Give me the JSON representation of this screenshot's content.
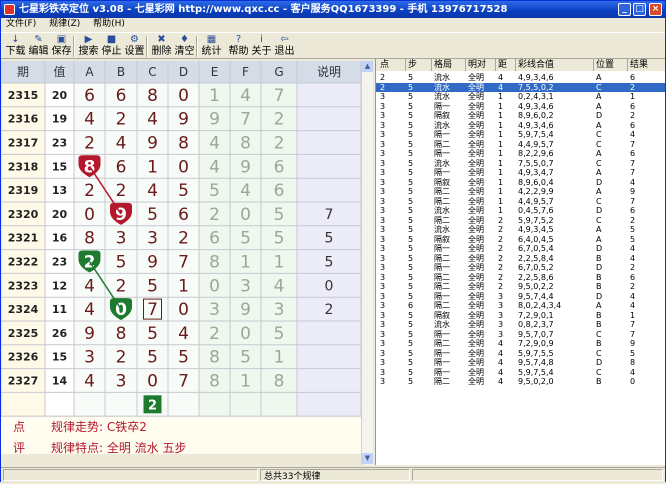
{
  "window": {
    "title": "七星彩铁卒定位 v3.08 - 七星彩网 http://www.qxc.cc - 客户服务QQ1673399 - 手机 13976717528",
    "min_label": "_",
    "max_label": "□",
    "close_label": "×"
  },
  "menu": [
    "文件(F)",
    "规律(Z)",
    "帮助(H)"
  ],
  "toolbar": [
    {
      "label": "下载",
      "icon": "download-icon",
      "glyph": "↓"
    },
    {
      "label": "编辑",
      "icon": "edit-icon",
      "glyph": "✎"
    },
    {
      "label": "保存",
      "icon": "save-icon",
      "glyph": "▣"
    },
    {
      "label": "搜索",
      "icon": "search-icon",
      "glyph": "▶"
    },
    {
      "label": "停止",
      "icon": "stop-icon",
      "glyph": "■"
    },
    {
      "label": "设置",
      "icon": "settings-icon",
      "glyph": "⚙"
    },
    {
      "label": "删除",
      "icon": "delete-icon",
      "glyph": "✖"
    },
    {
      "label": "清空",
      "icon": "clear-icon",
      "glyph": "♦"
    },
    {
      "label": "统计",
      "icon": "stats-icon",
      "glyph": "▦"
    },
    {
      "label": "帮助",
      "icon": "help-icon",
      "glyph": "?"
    },
    {
      "label": "关于",
      "icon": "about-icon",
      "glyph": "i"
    },
    {
      "label": "退出",
      "icon": "exit-icon",
      "glyph": "⇦"
    }
  ],
  "grid": {
    "headers": [
      "期",
      "值",
      "A",
      "B",
      "C",
      "D",
      "E",
      "F",
      "G",
      "说明"
    ],
    "rows": [
      {
        "period": "2315",
        "value": "20",
        "digits": [
          "6",
          "6",
          "8",
          "0",
          "1",
          "4",
          "7"
        ],
        "note": ""
      },
      {
        "period": "2316",
        "value": "19",
        "digits": [
          "4",
          "2",
          "4",
          "9",
          "9",
          "7",
          "2"
        ],
        "note": ""
      },
      {
        "period": "2317",
        "value": "23",
        "digits": [
          "2",
          "4",
          "9",
          "8",
          "4",
          "8",
          "2"
        ],
        "note": ""
      },
      {
        "period": "2318",
        "value": "15",
        "digits": [
          "8",
          "6",
          "1",
          "0",
          "4",
          "9",
          "6"
        ],
        "note": ""
      },
      {
        "period": "2319",
        "value": "13",
        "digits": [
          "2",
          "2",
          "4",
          "5",
          "5",
          "4",
          "6"
        ],
        "note": ""
      },
      {
        "period": "2320",
        "value": "20",
        "digits": [
          "0",
          "9",
          "5",
          "6",
          "2",
          "0",
          "5"
        ],
        "note": "7"
      },
      {
        "period": "2321",
        "value": "16",
        "digits": [
          "8",
          "3",
          "3",
          "2",
          "6",
          "5",
          "5"
        ],
        "note": "5"
      },
      {
        "period": "2322",
        "value": "23",
        "digits": [
          "2",
          "5",
          "9",
          "7",
          "8",
          "1",
          "1"
        ],
        "note": "5"
      },
      {
        "period": "2323",
        "value": "12",
        "digits": [
          "4",
          "2",
          "5",
          "1",
          "0",
          "3",
          "4"
        ],
        "note": "0"
      },
      {
        "period": "2324",
        "value": "11",
        "digits": [
          "4",
          "0",
          "7",
          "0",
          "3",
          "9",
          "3"
        ],
        "note": "2"
      },
      {
        "period": "2325",
        "value": "26",
        "digits": [
          "9",
          "8",
          "5",
          "4",
          "2",
          "0",
          "5"
        ],
        "note": ""
      },
      {
        "period": "2326",
        "value": "15",
        "digits": [
          "3",
          "2",
          "5",
          "5",
          "8",
          "5",
          "1"
        ],
        "note": ""
      },
      {
        "period": "2327",
        "value": "14",
        "digits": [
          "4",
          "3",
          "0",
          "7",
          "8",
          "1",
          "8"
        ],
        "note": ""
      }
    ],
    "next_hint": "2",
    "info_label_1": "点",
    "info_label_2": "评",
    "info_line_1": "规律走势: C铁卒2",
    "info_line_2": "规律特点: 全明  流水  五步"
  },
  "list": {
    "headers": [
      "点",
      "步",
      "格局",
      "明对",
      "距",
      "彩线合值",
      "位置",
      "结果"
    ],
    "rows": [
      [
        "2",
        "5",
        "流水",
        "全明",
        "4",
        "4,9,3,4,6",
        "A",
        "6"
      ],
      [
        "2",
        "5",
        "流水",
        "全明",
        "4",
        "7,5,5,0,2",
        "C",
        "2"
      ],
      [
        "3",
        "5",
        "流水",
        "全明",
        "1",
        "0,2,4,3,1",
        "A",
        "1"
      ],
      [
        "3",
        "5",
        "隔一",
        "全明",
        "1",
        "4,9,3,4,6",
        "A",
        "6"
      ],
      [
        "3",
        "5",
        "隔叙",
        "全明",
        "1",
        "8,9,6,0,2",
        "D",
        "2"
      ],
      [
        "3",
        "5",
        "流水",
        "全明",
        "1",
        "4,9,3,4,6",
        "A",
        "6"
      ],
      [
        "3",
        "5",
        "隔一",
        "全明",
        "1",
        "5,9,7,5,4",
        "C",
        "4"
      ],
      [
        "3",
        "5",
        "隔二",
        "全明",
        "1",
        "4,4,9,5,7",
        "C",
        "7"
      ],
      [
        "3",
        "5",
        "隔一",
        "全明",
        "1",
        "8,2,2,9,6",
        "A",
        "6"
      ],
      [
        "3",
        "5",
        "流水",
        "全明",
        "1",
        "7,5,5,0,7",
        "C",
        "7"
      ],
      [
        "3",
        "5",
        "隔一",
        "全明",
        "1",
        "4,9,3,4,7",
        "A",
        "7"
      ],
      [
        "3",
        "5",
        "隔叙",
        "全明",
        "1",
        "8,9,6,0,4",
        "D",
        "4"
      ],
      [
        "3",
        "5",
        "隔二",
        "全明",
        "1",
        "4,2,2,9,9",
        "A",
        "9"
      ],
      [
        "3",
        "5",
        "隔二",
        "全明",
        "1",
        "4,4,9,5,7",
        "C",
        "7"
      ],
      [
        "3",
        "5",
        "流水",
        "全明",
        "1",
        "0,4,5,7,6",
        "D",
        "6"
      ],
      [
        "3",
        "5",
        "隔二",
        "全明",
        "2",
        "5,9,7,5,2",
        "C",
        "2"
      ],
      [
        "3",
        "5",
        "流水",
        "全明",
        "2",
        "4,9,3,4,5",
        "A",
        "5"
      ],
      [
        "3",
        "5",
        "隔叙",
        "全明",
        "2",
        "6,4,0,4,5",
        "A",
        "5"
      ],
      [
        "3",
        "5",
        "隔一",
        "全明",
        "2",
        "6,7,0,5,4",
        "D",
        "4"
      ],
      [
        "3",
        "5",
        "隔二",
        "全明",
        "2",
        "2,2,5,8,4",
        "B",
        "4"
      ],
      [
        "3",
        "5",
        "隔一",
        "全明",
        "2",
        "6,7,0,5,2",
        "D",
        "2"
      ],
      [
        "3",
        "5",
        "隔二",
        "全明",
        "2",
        "2,2,5,8,6",
        "B",
        "6"
      ],
      [
        "3",
        "5",
        "隔二",
        "全明",
        "2",
        "9,5,0,2,2",
        "B",
        "2"
      ],
      [
        "3",
        "5",
        "隔一",
        "全明",
        "3",
        "9,5,7,4,4",
        "D",
        "4"
      ],
      [
        "3",
        "6",
        "隔二",
        "全明",
        "3",
        "8,0,2,4,3,4",
        "A",
        "4"
      ],
      [
        "3",
        "5",
        "隔叙",
        "全明",
        "3",
        "7,2,9,0,1",
        "B",
        "1"
      ],
      [
        "3",
        "5",
        "流水",
        "全明",
        "3",
        "0,8,2,3,7",
        "B",
        "7"
      ],
      [
        "3",
        "5",
        "隔一",
        "全明",
        "3",
        "9,5,7,0,7",
        "C",
        "7"
      ],
      [
        "3",
        "5",
        "隔二",
        "全明",
        "4",
        "7,2,9,0,9",
        "B",
        "9"
      ],
      [
        "3",
        "5",
        "隔一",
        "全明",
        "4",
        "5,9,7,5,5",
        "C",
        "5"
      ],
      [
        "3",
        "5",
        "隔一",
        "全明",
        "4",
        "9,5,7,4,8",
        "D",
        "8"
      ],
      [
        "3",
        "5",
        "隔一",
        "全明",
        "4",
        "5,9,7,5,4",
        "C",
        "4"
      ],
      [
        "3",
        "5",
        "隔二",
        "全明",
        "4",
        "9,5,0,2,0",
        "B",
        "0"
      ]
    ],
    "selected_index": 1
  },
  "status": {
    "summary": "总共33个规律"
  }
}
